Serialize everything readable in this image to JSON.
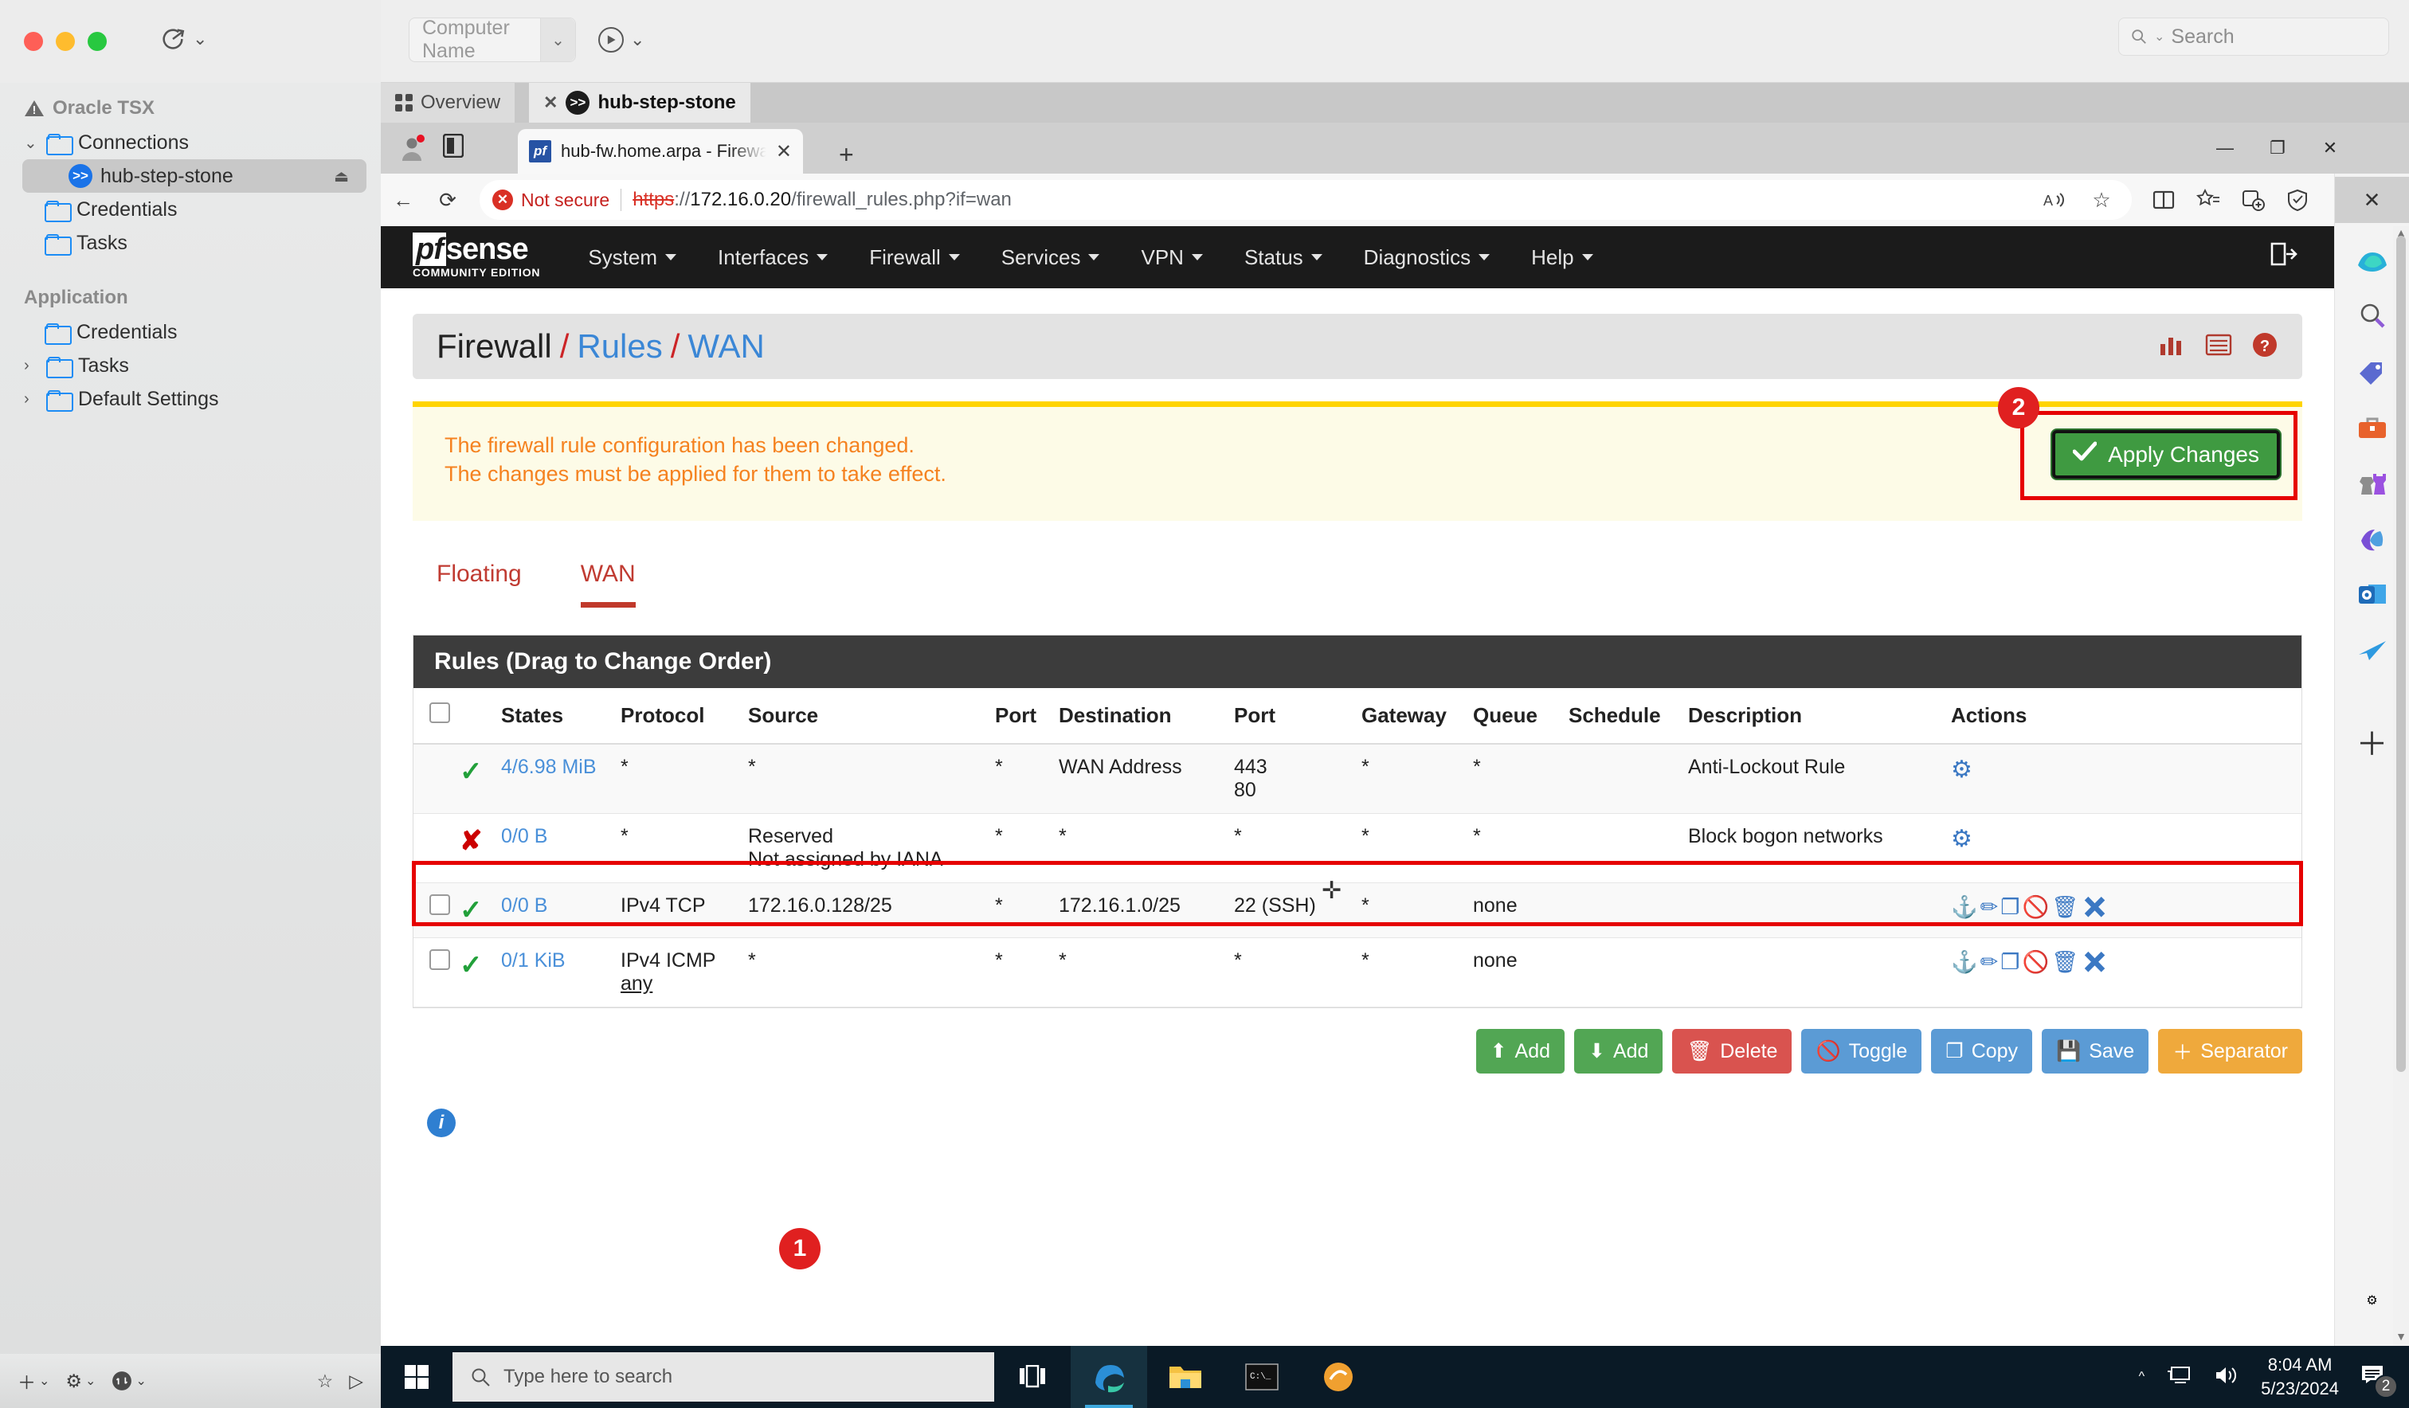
{
  "mac": {
    "window_controls": [
      "close",
      "minimize",
      "maximize"
    ],
    "computer_name_placeholder": "Computer Name",
    "search_placeholder": "Search",
    "tree": {
      "root_label": "Oracle TSX",
      "connections_group": "Connections",
      "items": [
        {
          "label": "hub-step-stone",
          "icon": "ssh-icon",
          "selected": true,
          "eject": true
        },
        {
          "label": "Credentials",
          "icon": "folder-icon",
          "selected": false
        },
        {
          "label": "Tasks",
          "icon": "folder-icon",
          "selected": false
        }
      ],
      "application_group": "Application",
      "app_items": [
        {
          "label": "Credentials",
          "icon": "folder-icon",
          "expandable": false
        },
        {
          "label": "Tasks",
          "icon": "folder-icon",
          "expandable": true
        },
        {
          "label": "Default Settings",
          "icon": "folder-icon",
          "expandable": true
        }
      ]
    },
    "session_tabs": [
      {
        "label": "Overview",
        "icon": "grid-icon",
        "active": false
      },
      {
        "label": "hub-step-stone",
        "icon": "ssh-icon",
        "active": true,
        "closable": true
      }
    ]
  },
  "edge": {
    "tab_title": "hub-fw.home.arpa - Firewall: Rules",
    "favicon": "pfsense-favicon",
    "new_tab_label": "+",
    "window_buttons": {
      "minimize": "—",
      "maximize": "❐",
      "close": "✕"
    },
    "security_label": "Not secure",
    "url": {
      "scheme": "https",
      "separator": "://",
      "host": "172.16.0.20",
      "path": "/firewall_rules.php?if=wan"
    },
    "toolbar_icons": [
      "back-icon",
      "refresh-icon",
      "read-aloud-icon",
      "favorite-star-icon",
      "split-screen-icon",
      "favorites-icon",
      "collections-icon",
      "browser-essentials-icon",
      "settings-more-icon",
      "copilot-icon"
    ],
    "sidebar_icons": [
      "sidebar-close-icon",
      "copilot-icon",
      "search-icon",
      "shopping-icon",
      "tools-icon",
      "games-icon",
      "office-icon",
      "outlook-icon",
      "mail-icon",
      "add-sidebar-icon",
      "sidebar-settings-icon"
    ]
  },
  "pfsense": {
    "brand": {
      "name": "pfsense",
      "edition": "COMMUNITY EDITION"
    },
    "nav": [
      {
        "label": "System",
        "has_caret": true
      },
      {
        "label": "Interfaces",
        "has_caret": true
      },
      {
        "label": "Firewall",
        "has_caret": true
      },
      {
        "label": "Services",
        "has_caret": true
      },
      {
        "label": "VPN",
        "has_caret": true
      },
      {
        "label": "Status",
        "has_caret": true
      },
      {
        "label": "Diagnostics",
        "has_caret": true
      },
      {
        "label": "Help",
        "has_caret": true
      }
    ],
    "logout_icon": "logout-icon",
    "breadcrumb": {
      "part1": "Firewall",
      "sep": "/",
      "part2": "Rules",
      "part3": "WAN"
    },
    "header_icons": [
      "statistics-icon",
      "list-icon",
      "help-icon"
    ],
    "alert": {
      "line1": "The firewall rule configuration has been changed.",
      "line2": "The changes must be applied for them to take effect."
    },
    "apply_button": "Apply Changes",
    "steps": {
      "row_badge": "1",
      "apply_badge": "2"
    },
    "tabs": [
      {
        "label": "Floating",
        "active": false
      },
      {
        "label": "WAN",
        "active": true
      }
    ],
    "rules_panel_title": "Rules (Drag to Change Order)",
    "columns": [
      "",
      "States",
      "Protocol",
      "Source",
      "Port",
      "Destination",
      "Port",
      "Gateway",
      "Queue",
      "Schedule",
      "Description",
      "Actions"
    ],
    "rows": [
      {
        "checkbox": false,
        "status": "pass",
        "states": "4/6.98 MiB",
        "protocol": "*",
        "source": "*",
        "source_sub": "",
        "src_port": "*",
        "destination": "WAN Address",
        "dst_port": "443",
        "dst_port2": "80",
        "gateway": "*",
        "queue": "*",
        "schedule": "",
        "description": "Anti-Lockout Rule",
        "actions": "gear",
        "has_checkbox": false
      },
      {
        "checkbox": false,
        "status": "block",
        "states": "0/0 B",
        "protocol": "*",
        "source": "Reserved",
        "source_sub": "Not assigned by IANA",
        "src_port": "*",
        "destination": "*",
        "dst_port": "*",
        "dst_port2": "",
        "gateway": "*",
        "queue": "*",
        "schedule": "",
        "description": "Block bogon networks",
        "actions": "gear",
        "has_checkbox": false
      },
      {
        "checkbox": false,
        "status": "pass",
        "states": "0/0 B",
        "protocol": "IPv4 TCP",
        "source": "172.16.0.128/25",
        "source_sub": "",
        "src_port": "*",
        "destination": "172.16.1.0/25",
        "dst_port": "22 (SSH)",
        "dst_port2": "",
        "gateway": "*",
        "queue": "none",
        "schedule": "",
        "description": "",
        "actions": "full",
        "has_checkbox": true,
        "highlighted": true
      },
      {
        "checkbox": false,
        "status": "pass",
        "states": "0/1 KiB",
        "protocol": "IPv4 ICMP",
        "source": "*",
        "source_sub": "any",
        "src_port": "*",
        "destination": "*",
        "dst_port": "*",
        "dst_port2": "",
        "gateway": "*",
        "queue": "none",
        "schedule": "",
        "description": "",
        "actions": "full",
        "has_checkbox": true
      }
    ],
    "action_icons": [
      "anchor-icon",
      "edit-pencil-icon",
      "copy-icon",
      "disable-icon",
      "delete-trash-icon",
      "remove-x-icon"
    ],
    "buttons": [
      {
        "label": "Add",
        "icon": "arrow-up-icon",
        "color": "green"
      },
      {
        "label": "Add",
        "icon": "arrow-down-icon",
        "color": "green"
      },
      {
        "label": "Delete",
        "icon": "trash-icon",
        "color": "red"
      },
      {
        "label": "Toggle",
        "icon": "ban-icon",
        "color": "blue"
      },
      {
        "label": "Copy",
        "icon": "copy-icon",
        "color": "blue"
      },
      {
        "label": "Save",
        "icon": "save-icon",
        "color": "blue"
      },
      {
        "label": "Separator",
        "icon": "plus-icon",
        "color": "orange"
      }
    ],
    "colors": {
      "accent_red": "#c0392b",
      "apply_green": "#3f9a41",
      "alert_bar": "#ffd400",
      "alert_text": "#f58220",
      "link_blue": "#3b87d6",
      "highlight_red": "#e60000"
    }
  },
  "windows": {
    "taskbar_search_placeholder": "Type here to search",
    "taskbar_apps": [
      "task-view-icon",
      "edge-icon",
      "file-explorer-icon",
      "terminal-icon",
      "other-app-icon"
    ],
    "tray_icons": [
      "show-hidden-icon",
      "network-icon",
      "volume-icon"
    ],
    "clock_time": "8:04 AM",
    "clock_date": "5/23/2024",
    "notification_count": "2"
  }
}
